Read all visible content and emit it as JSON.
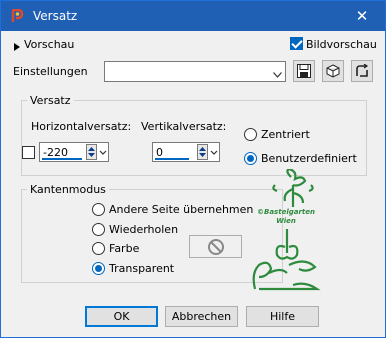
{
  "window": {
    "title": "Versatz",
    "close_glyph": "✕"
  },
  "header": {
    "preview_label": "Vorschau",
    "image_preview_label": "Bildvorschau",
    "image_preview_checked": true
  },
  "settings": {
    "label": "Einstellungen",
    "value": ""
  },
  "offset": {
    "legend": "Versatz",
    "horizontal_label": "Horizontalversatz:",
    "horizontal_value": "-220",
    "vertical_label": "Vertikalversatz:",
    "vertical_value": "0",
    "centered_label": "Zentriert",
    "custom_label": "Benutzerdefiniert",
    "selected": "custom"
  },
  "edge_mode": {
    "legend": "Kantenmodus",
    "options": [
      "Andere Seite übernehmen",
      "Wiederholen",
      "Farbe",
      "Transparent"
    ],
    "selected": "Transparent"
  },
  "watermark": {
    "line1": "©Bastelgarten",
    "line2": "Wien"
  },
  "buttons": {
    "ok": "OK",
    "cancel": "Abbrechen",
    "help": "Hilfe"
  },
  "colors": {
    "title_bar": "#1f5fb4",
    "accent": "#0067c0",
    "watermark": "#2e8b3e"
  }
}
